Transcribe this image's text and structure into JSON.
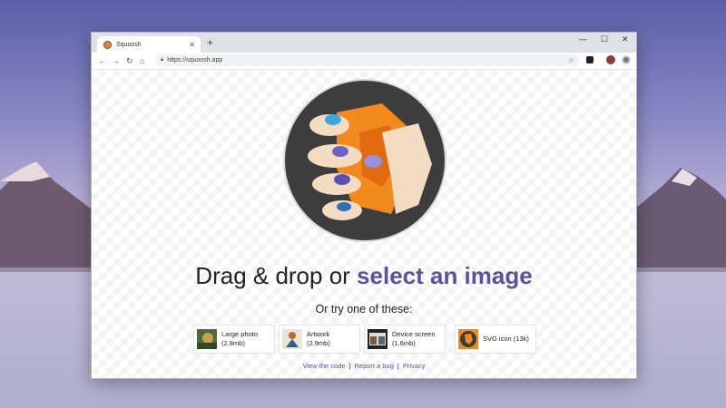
{
  "browser": {
    "tab_title": "Squoosh",
    "url": "https://squoosh.app"
  },
  "page": {
    "headline_prefix": "Drag & drop or ",
    "headline_link": "select an image",
    "subline": "Or try one of these:",
    "samples": [
      {
        "title": "Large photo",
        "size": "(2.8mb)",
        "icon": "photo-thumbnail"
      },
      {
        "title": "Artwork",
        "size": "(2.9mb)",
        "icon": "artwork-thumbnail"
      },
      {
        "title": "Device screen",
        "size": "(1.6mb)",
        "icon": "device-screen-thumbnail"
      },
      {
        "title": "SVG icon (13k)",
        "size": "",
        "icon": "svg-icon-thumbnail"
      }
    ],
    "footer": {
      "view_code": "View the code",
      "report_bug": "Report a bug",
      "privacy": "Privacy"
    }
  },
  "colors": {
    "accent": "#5d509e",
    "logo_orange": "#f28a1e",
    "logo_dark": "#3d3d3d"
  }
}
